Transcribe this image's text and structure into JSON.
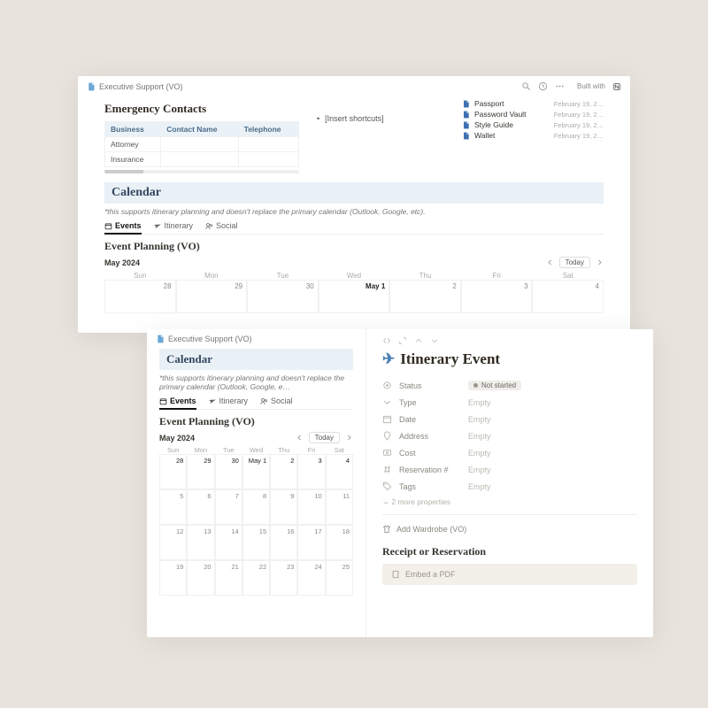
{
  "cardA": {
    "crumb": "Executive Support (VO)",
    "builtwith": "Built with",
    "emergency": {
      "title": "Emergency Contacts",
      "cols": [
        "Business",
        "Contact Name",
        "Telephone"
      ],
      "rows": [
        "Attorney",
        "Insurance"
      ]
    },
    "shortcut": "[Insert shortcuts]",
    "files": [
      {
        "name": "Passport",
        "date": "February 19, 2…"
      },
      {
        "name": "Password Vault",
        "date": "February 19, 2…"
      },
      {
        "name": "Style Guide",
        "date": "February 19, 2…"
      },
      {
        "name": "Wallet",
        "date": "February 19, 2…"
      }
    ],
    "calTitle": "Calendar",
    "calNote": "*this supports itinerary planning and doesn't replace the primary calendar (Outlook, Google, etc).",
    "tabs": {
      "events": "Events",
      "itinerary": "Itinerary",
      "social": "Social"
    },
    "epTitle": "Event Planning (VO)",
    "month": "May 2024",
    "today": "Today",
    "dow": [
      "Sun",
      "Mon",
      "Tue",
      "Wed",
      "Thu",
      "Fri",
      "Sat"
    ],
    "row1": [
      "28",
      "29",
      "30",
      "May 1",
      "2",
      "3",
      "4"
    ]
  },
  "cardB": {
    "crumb": "Executive Support (VO)",
    "calTitle": "Calendar",
    "calNote": "*this supports itinerary planning and doesn't replace the primary calendar (Outlook, Google, e…",
    "tabs": {
      "events": "Events",
      "itinerary": "Itinerary",
      "social": "Social"
    },
    "epTitle": "Event Planning (VO)",
    "month": "May 2024",
    "today": "Today",
    "dow": [
      "Sun",
      "Mon",
      "Tue",
      "Wed",
      "Thu",
      "Fri",
      "Sat"
    ],
    "weeks": [
      [
        "28",
        "29",
        "30",
        "May 1",
        "2",
        "3",
        "4"
      ],
      [
        "5",
        "6",
        "7",
        "8",
        "9",
        "10",
        "11"
      ],
      [
        "12",
        "13",
        "14",
        "15",
        "16",
        "17",
        "18"
      ],
      [
        "19",
        "20",
        "21",
        "22",
        "23",
        "24",
        "25"
      ]
    ]
  },
  "panel": {
    "title": "Itinerary Event",
    "status": {
      "label": "Status",
      "value": "Not started"
    },
    "props": [
      {
        "icon": "chevron",
        "label": "Type",
        "value": "Empty"
      },
      {
        "icon": "cal",
        "label": "Date",
        "value": "Empty"
      },
      {
        "icon": "pin",
        "label": "Address",
        "value": "Empty"
      },
      {
        "icon": "cost",
        "label": "Cost",
        "value": "Empty"
      },
      {
        "icon": "hash",
        "label": "Reservation #",
        "value": "Empty"
      },
      {
        "icon": "tag",
        "label": "Tags",
        "value": "Empty"
      }
    ],
    "more": "2 more properties",
    "addWardrobe": "Add Wardrobe (VO)",
    "receiptTitle": "Receipt or Reservation",
    "embed": "Embed a PDF"
  }
}
